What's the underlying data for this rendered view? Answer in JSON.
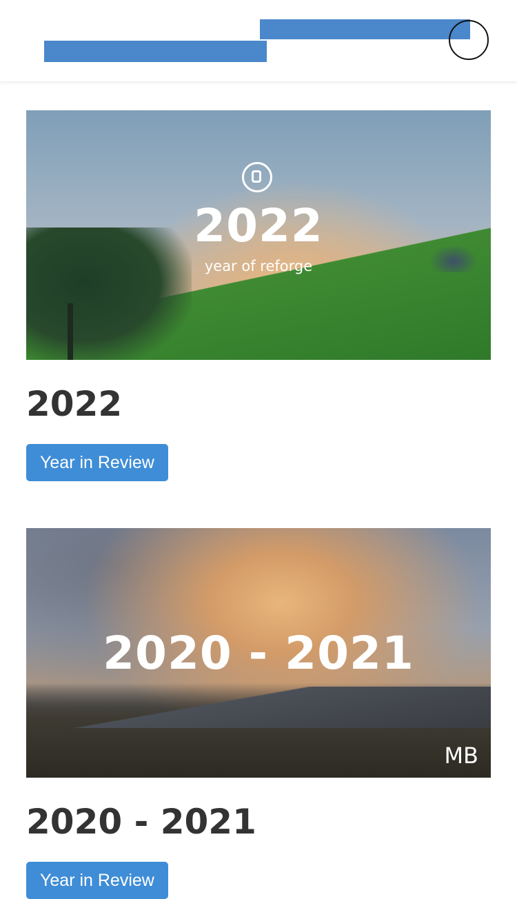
{
  "header": {
    "logo": "site-logo-bars",
    "menu_icon": "menu-circle-icon",
    "brand_color": "#4a87cb"
  },
  "cards": [
    {
      "image_year": "2022",
      "image_subtitle": "year of reforge",
      "title": "2022",
      "button_label": "Year in Review"
    },
    {
      "image_year": "2020 - 2021",
      "image_mark": "MB",
      "title": "2020 - 2021",
      "button_label": "Year in Review"
    }
  ],
  "colors": {
    "button": "#3f8dd6",
    "title_text": "#333333"
  }
}
